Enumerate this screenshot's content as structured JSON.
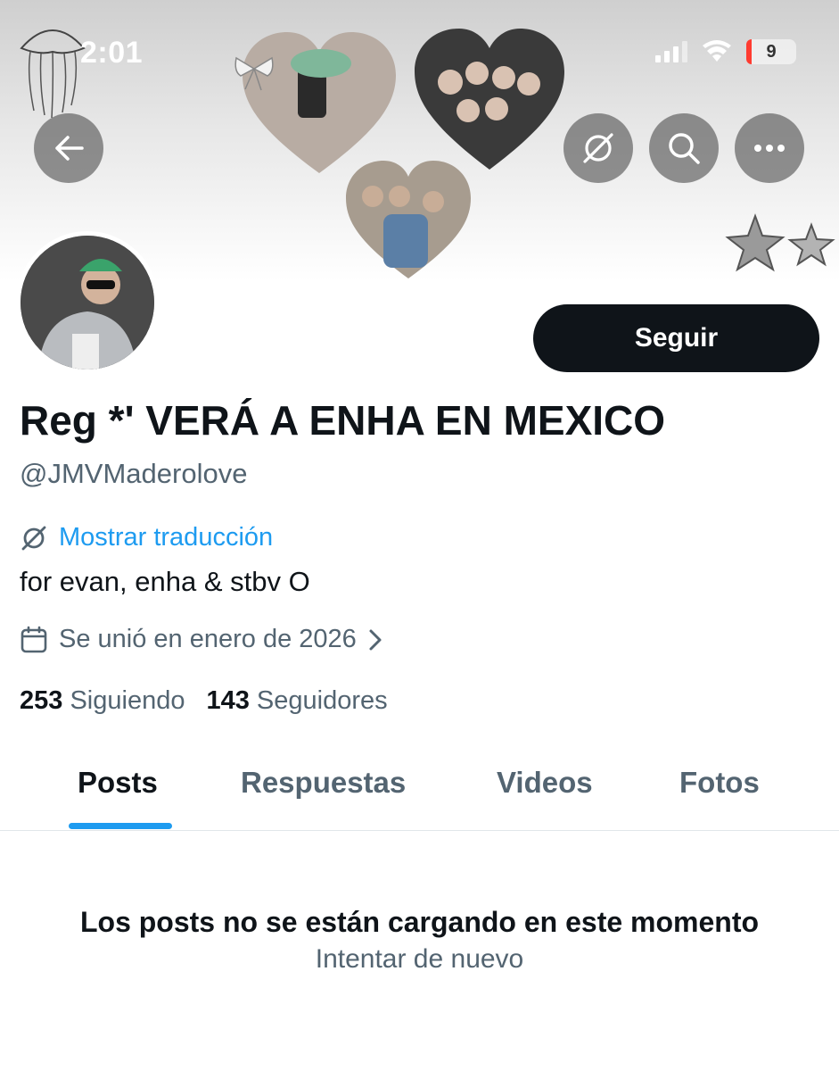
{
  "status_bar": {
    "time": "2:01",
    "battery_level": "9",
    "icons": [
      "signal-icon",
      "wifi-icon",
      "battery-icon"
    ]
  },
  "header": {
    "buttons": [
      "back-arrow-icon",
      "translate-icon",
      "search-icon",
      "more-icon"
    ]
  },
  "profile": {
    "display_name": "Reg *' VERÁ A ENHA EN MEXICO",
    "handle": "@JMVMaderolove",
    "follow_label": "Seguir",
    "translate_label": "Mostrar traducción",
    "bio": "for evan, enha & stbv O",
    "joined": "Se unió en enero de 2026",
    "following_count": "253",
    "following_label": "Siguiendo",
    "followers_count": "143",
    "followers_label": "Seguidores"
  },
  "tabs": [
    {
      "label": "Posts",
      "active": true
    },
    {
      "label": "Respuestas",
      "active": false
    },
    {
      "label": "Videos",
      "active": false
    },
    {
      "label": "Fotos",
      "active": false
    }
  ],
  "feed": {
    "error_message": "Los posts no se están cargando en este momento",
    "retry_label": "Intentar de nuevo"
  },
  "colors": {
    "accent": "#1d9bf0",
    "text_primary": "#0f1419",
    "text_secondary": "#536471",
    "follow_button": "#0f1419"
  }
}
